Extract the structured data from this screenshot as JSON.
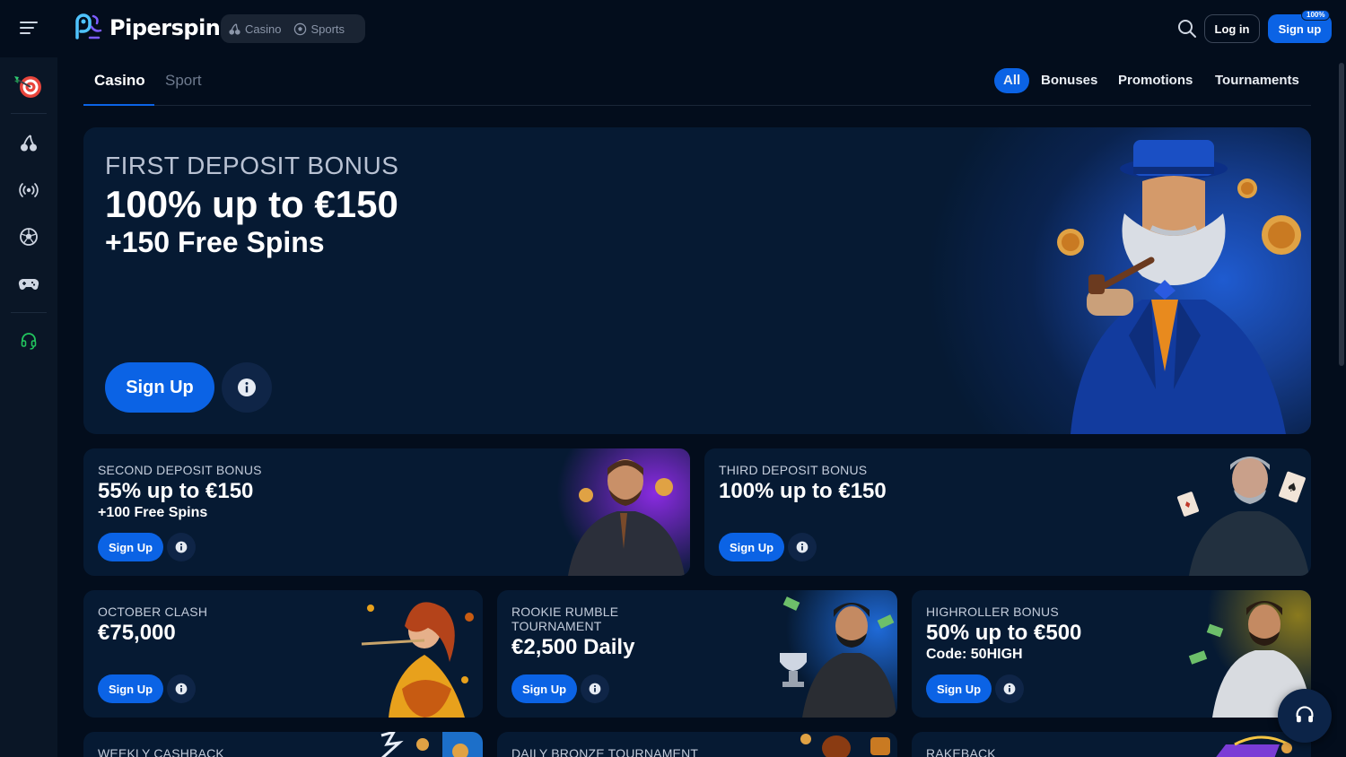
{
  "brand": {
    "name": "Piperspin"
  },
  "header": {
    "modes": [
      {
        "label": "Casino",
        "icon": "cherry-icon"
      },
      {
        "label": "Sports",
        "icon": "soccer-ball-icon"
      }
    ],
    "login_label": "Log in",
    "signup_label": "Sign up",
    "signup_badge": "100%"
  },
  "sidebar": {
    "items": [
      {
        "icon": "dart-target-icon"
      },
      {
        "icon": "cherry-icon"
      },
      {
        "icon": "live-broadcast-icon"
      },
      {
        "icon": "soccer-ball-icon"
      },
      {
        "icon": "gamepad-icon"
      },
      {
        "icon": "support-headset-icon"
      }
    ]
  },
  "tabs": {
    "main": [
      {
        "label": "Casino",
        "active": true
      },
      {
        "label": "Sport",
        "active": false
      }
    ],
    "filters": [
      {
        "label": "All",
        "active": true
      },
      {
        "label": "Bonuses",
        "active": false
      },
      {
        "label": "Promotions",
        "active": false
      },
      {
        "label": "Tournaments",
        "active": false
      }
    ]
  },
  "hero": {
    "kicker": "FIRST DEPOSIT BONUS",
    "title": "100% up to €150",
    "subtitle": "+150 Free Spins",
    "button_label": "Sign Up"
  },
  "cards": [
    {
      "kicker": "SECOND DEPOSIT BONUS",
      "title": "55% up to €150",
      "subtitle": "+100 Free Spins",
      "button_label": "Sign Up"
    },
    {
      "kicker": "THIRD DEPOSIT BONUS",
      "title": "100% up to €150",
      "subtitle": "",
      "button_label": "Sign Up"
    },
    {
      "kicker": "OCTOBER CLASH",
      "title": "€75,000",
      "subtitle": "",
      "button_label": "Sign Up"
    },
    {
      "kicker": "ROOKIE RUMBLE TOURNAMENT",
      "title": "€2,500 Daily",
      "subtitle": "",
      "button_label": "Sign Up"
    },
    {
      "kicker": "HIGHROLLER BONUS",
      "title": "50% up to €500",
      "subtitle": "Code: 50HIGH",
      "button_label": "Sign Up"
    }
  ],
  "bottom_cards": [
    {
      "kicker": "WEEKLY CASHBACK"
    },
    {
      "kicker": "DAILY BRONZE TOURNAMENT"
    },
    {
      "kicker": "RAKEBACK"
    }
  ],
  "colors": {
    "background": "#030d1c",
    "accent": "#0b63e5",
    "card": "#061a33",
    "sidebar": "#0a1626",
    "support_icon": "#22c55e"
  }
}
